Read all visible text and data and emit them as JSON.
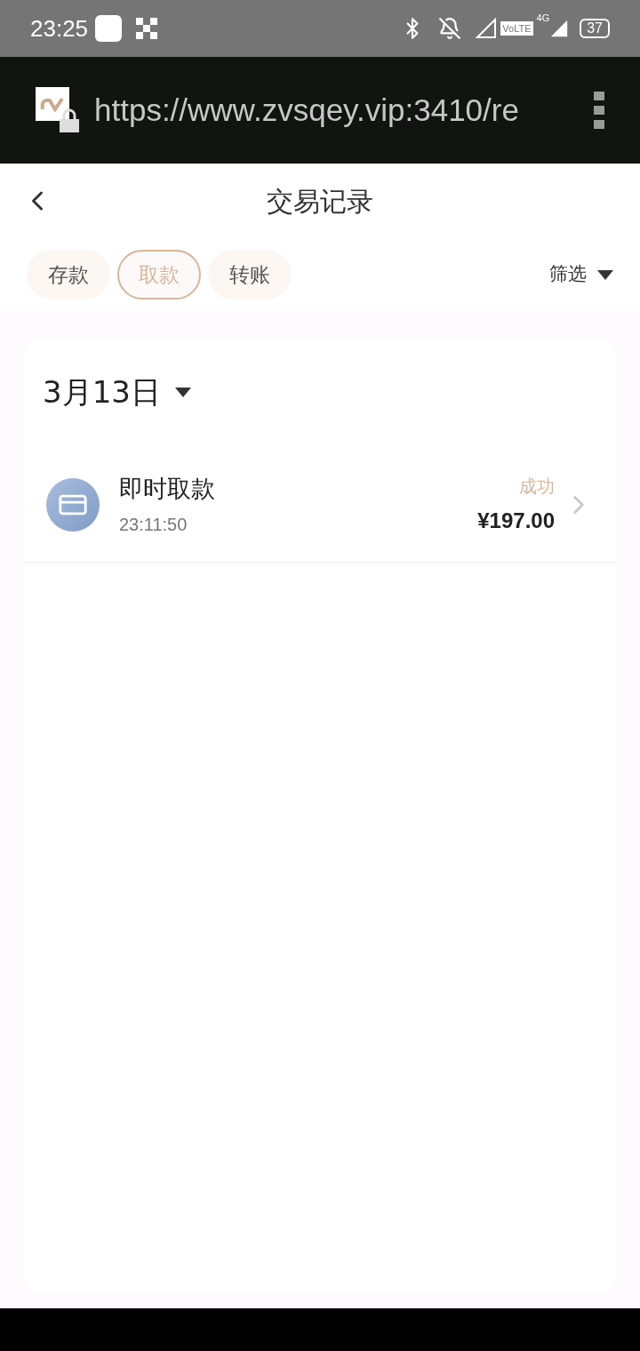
{
  "status_bar": {
    "time": "23:25",
    "volte": "VoLTE",
    "network": "4G",
    "battery": "37"
  },
  "browser": {
    "url": "https://www.zvsqey.vip:3410/re"
  },
  "header": {
    "title": "交易记录"
  },
  "tabs": [
    {
      "label": "存款",
      "selected": false
    },
    {
      "label": "取款",
      "selected": true
    },
    {
      "label": "转账",
      "selected": false
    }
  ],
  "filter": {
    "label": "筛选"
  },
  "groups": [
    {
      "date": "3月13日",
      "records": [
        {
          "title": "即时取款",
          "time": "23:11:50",
          "status": "成功",
          "amount": "¥197.00"
        }
      ]
    }
  ]
}
